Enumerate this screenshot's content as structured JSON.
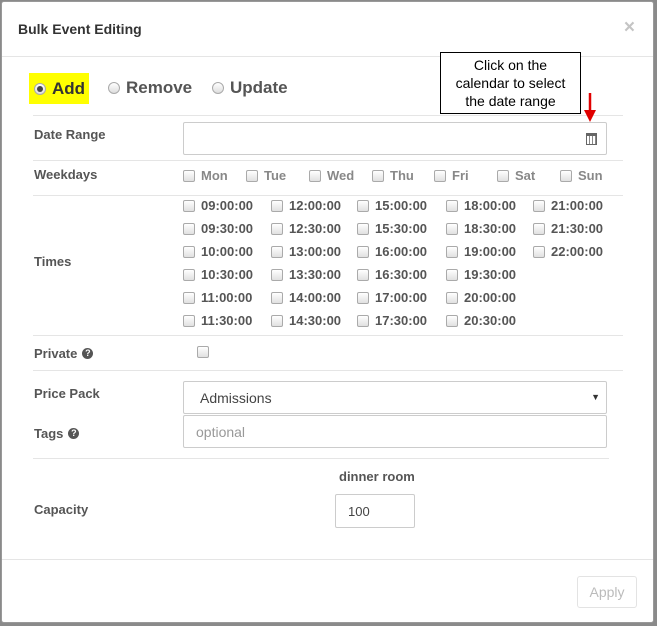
{
  "dialog": {
    "title": "Bulk Event Editing",
    "close_glyph": "×"
  },
  "modes": [
    {
      "label": "Add",
      "selected": true
    },
    {
      "label": "Remove",
      "selected": false
    },
    {
      "label": "Update",
      "selected": false
    }
  ],
  "date_range": {
    "label": "Date Range",
    "value": ""
  },
  "weekdays": {
    "label": "Weekdays",
    "days": [
      "Mon",
      "Tue",
      "Wed",
      "Thu",
      "Fri",
      "Sat",
      "Sun"
    ]
  },
  "times": {
    "label": "Times",
    "columns": [
      [
        "09:00:00",
        "09:30:00",
        "10:00:00",
        "10:30:00",
        "11:00:00",
        "11:30:00"
      ],
      [
        "12:00:00",
        "12:30:00",
        "13:00:00",
        "13:30:00",
        "14:00:00",
        "14:30:00"
      ],
      [
        "15:00:00",
        "15:30:00",
        "16:00:00",
        "16:30:00",
        "17:00:00",
        "17:30:00"
      ],
      [
        "18:00:00",
        "18:30:00",
        "19:00:00",
        "19:30:00",
        "20:00:00",
        "20:30:00"
      ],
      [
        "21:00:00",
        "21:30:00",
        "22:00:00"
      ]
    ]
  },
  "private": {
    "label": "Private",
    "checked": false
  },
  "price_pack": {
    "label": "Price Pack",
    "selected": "Admissions"
  },
  "tags": {
    "label": "Tags",
    "placeholder": "optional"
  },
  "capacity": {
    "label": "Capacity",
    "column_header": "dinner room",
    "value": "100"
  },
  "footer": {
    "apply_label": "Apply"
  },
  "annotation": {
    "lines": [
      "Click on the",
      "calendar to select",
      "the date range"
    ],
    "arrow_color": "#e00000"
  },
  "colors": {
    "highlight": "#ffff00"
  },
  "icons": {
    "calendar": "calendar-icon",
    "help": "question-circle-icon",
    "close": "close-icon"
  }
}
